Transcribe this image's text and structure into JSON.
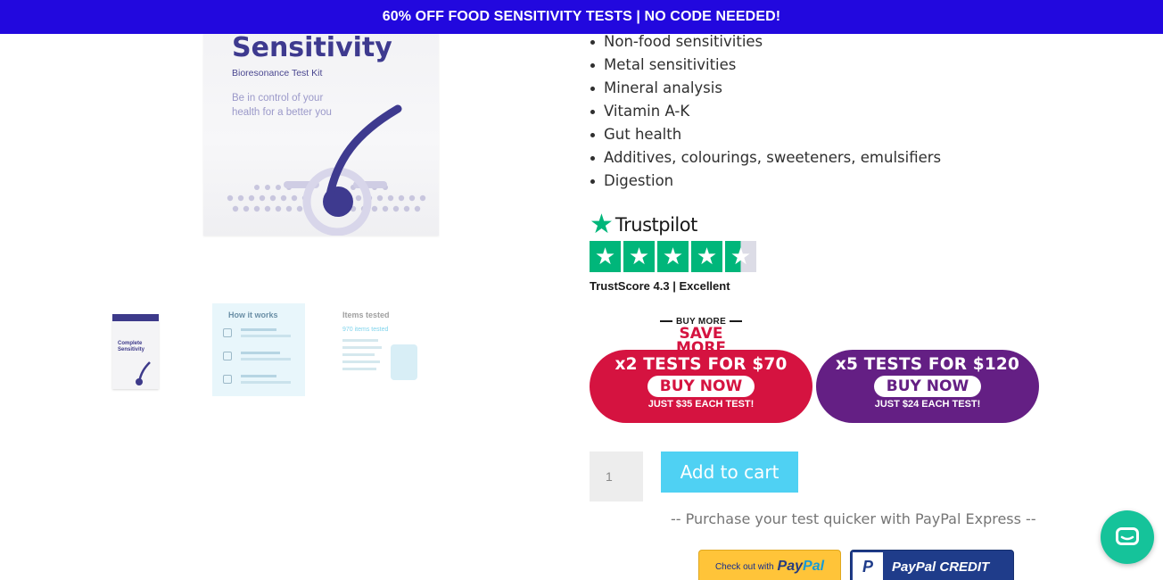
{
  "banner": {
    "text": "60% OFF FOOD SENSITIVITY TESTS | NO CODE NEEDED!"
  },
  "product_image": {
    "title": "Sensitivity",
    "subtitle": "Bioresonance Test Kit",
    "tagline_1": "Be in control of your",
    "tagline_2": "health for a better you"
  },
  "thumbnails": [
    {
      "name": "box",
      "title_1": "Complete",
      "title_2": "Sensitivity"
    },
    {
      "name": "how-it-works",
      "title": "How it works"
    },
    {
      "name": "items-tested",
      "title": "Items tested",
      "sub": "970 items tested"
    }
  ],
  "features": [
    "Non-food sensitivities",
    "Metal sensitivities",
    "Mineral analysis",
    "Vitamin A-K",
    "Gut health",
    "Additives, colourings, sweeteners, emulsifiers",
    "Digestion"
  ],
  "trustpilot": {
    "brand": "Trustpilot",
    "score_text": "TrustScore 4.3  |  Excellent",
    "rating": 4.5
  },
  "buy_more": {
    "top": "BUY MORE",
    "bottom": "SAVE MORE"
  },
  "promos": [
    {
      "head": "x2 TESTS FOR $70",
      "button": "BUY NOW",
      "foot": "JUST $35 EACH TEST!",
      "color": "#d51340"
    },
    {
      "head": "x5 TESTS FOR $120",
      "button": "BUY NOW",
      "foot": "JUST $24 EACH TEST!",
      "color": "#641f84"
    }
  ],
  "cart": {
    "quantity": "1",
    "add_label": "Add to cart"
  },
  "paypal": {
    "note": "-- Purchase your test quicker with PayPal Express --",
    "checkout_prefix": "Check out with",
    "checkout_brand_1": "Pay",
    "checkout_brand_2": "Pal",
    "credit_logo": "P",
    "credit_label": "PayPal CREDIT"
  },
  "colors": {
    "banner": "#2208de",
    "accent_cyan": "#4fd1f3",
    "trustpilot_green": "#00b67a",
    "chat": "#15c39a"
  },
  "chat": {
    "icon": "chat-icon"
  }
}
